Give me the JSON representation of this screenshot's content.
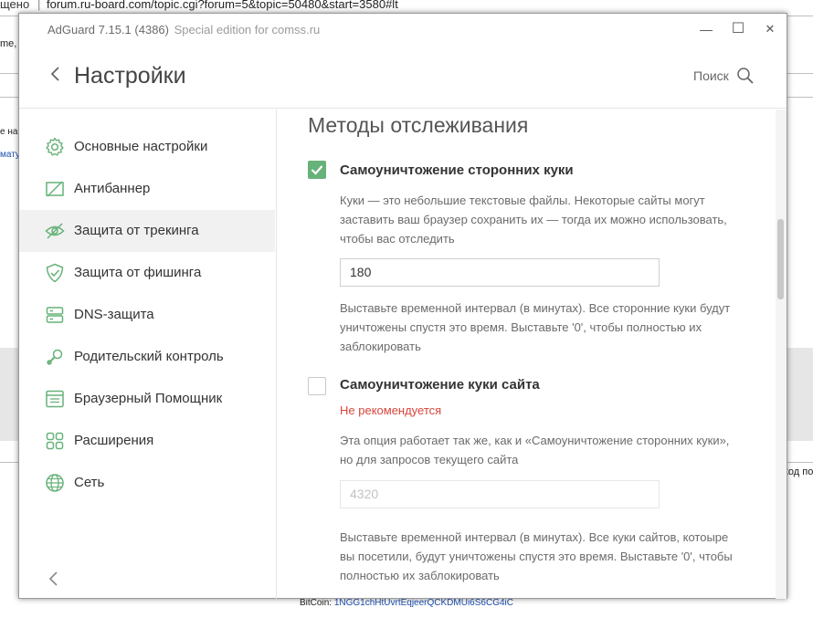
{
  "background": {
    "url_prefix": "щено",
    "url": "forum.ru-board.com/topic.cgi?forum=5&topic=50480&start=3580#lt",
    "left_fragments": [
      "me,",
      "е на",
      "мату"
    ],
    "right_fragment": "код по",
    "footer_label": "BitCoin:",
    "footer_hash": "1NGG1chHtUvrtEqjeerQCKDMUi6S6CG4iC"
  },
  "window": {
    "title": "AdGuard 7.15.1 (4386)",
    "subtitle": "Special edition for comss.ru",
    "minimize_glyph": "—",
    "maximize_glyph": "☐",
    "close_glyph": "✕"
  },
  "header": {
    "title": "Настройки",
    "search_label": "Поиск"
  },
  "sidebar": {
    "items": [
      {
        "label": "Основные настройки",
        "icon": "gear-icon"
      },
      {
        "label": "Антибаннер",
        "icon": "antibanner-icon"
      },
      {
        "label": "Защита от трекинга",
        "icon": "eye-crossed-icon",
        "active": true
      },
      {
        "label": "Защита от фишинга",
        "icon": "shield-check-icon"
      },
      {
        "label": "DNS-защита",
        "icon": "server-icon"
      },
      {
        "label": "Родительский контроль",
        "icon": "rattle-icon"
      },
      {
        "label": "Браузерный Помощник",
        "icon": "browser-icon"
      },
      {
        "label": "Расширения",
        "icon": "extensions-icon"
      },
      {
        "label": "Сеть",
        "icon": "globe-icon"
      }
    ]
  },
  "content": {
    "section_title": "Методы отслеживания",
    "option1": {
      "checked": true,
      "title": "Самоуничтожение сторонних куки",
      "desc": "Куки — это небольшие текстовые файлы. Некоторые сайты могут заставить ваш браузер сохранить их — тогда их можно использовать, чтобы вас отследить",
      "value": "180",
      "hint": "Выставьте временной интервал (в минутах). Все сторонние куки будут уничтожены спустя это время. Выставьте '0', чтобы полностью их заблокировать"
    },
    "option2": {
      "checked": false,
      "title": "Самоуничтожение куки сайта",
      "warning": "Не рекомендуется",
      "desc": "Эта опция работает так же, как и «Самоуничтожение сторонних куки», но для запросов текущего сайта",
      "value": "4320",
      "hint": "Выставьте временной интервал (в минутах). Все куки сайтов, котоыре вы посетили, будут уничтожены спустя это время. Выставьте '0', чтобы полностью их заблокировать"
    }
  },
  "colors": {
    "accent": "#67b279",
    "warning": "#d9453b",
    "icon": "#67b279"
  }
}
